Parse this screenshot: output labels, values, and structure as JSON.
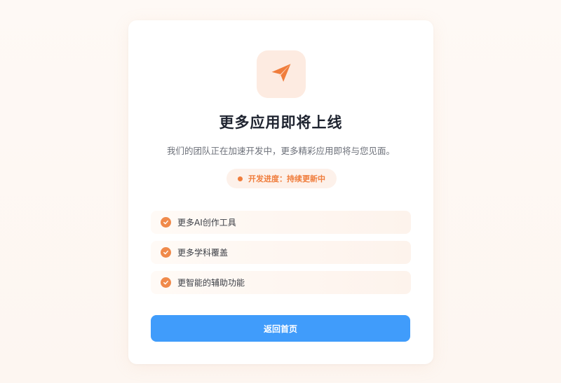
{
  "card": {
    "icon": "paper-plane-icon",
    "title": "更多应用即将上线",
    "subtitle": "我们的团队正在加速开发中，更多精彩应用即将与您见面。",
    "progress": "开发进度：持续更新中",
    "features": [
      {
        "icon": "check-circle-icon",
        "label": "更多AI创作工具"
      },
      {
        "icon": "check-circle-icon",
        "label": "更多学科覆盖"
      },
      {
        "icon": "check-circle-icon",
        "label": "更智能的辅助功能"
      }
    ],
    "button_label": "返回首页"
  },
  "colors": {
    "accent": "#f07d3c",
    "button": "#409cfb",
    "icon_tile": "#fdebe1"
  }
}
